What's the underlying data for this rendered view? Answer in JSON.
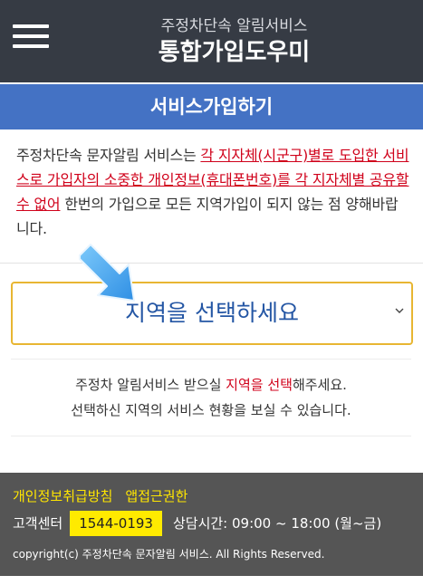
{
  "header": {
    "subtitle": "주정차단속 알림서비스",
    "title": "통합가입도우미"
  },
  "section": {
    "title": "서비스가입하기"
  },
  "notice": {
    "part1": "주정차단속 문자알림 서비스는 ",
    "highlight": "각 지자체(시군구)별로 도입한 서비스로 가입자의 소중한 개인정보(휴대폰번호)를 각 지자체별 공유할 수 없어",
    "part2": " 한번의 가입으로 모든 지역가입이 되지 않는 점 양해바랍니다."
  },
  "region_select": {
    "label": "지역을 선택하세요",
    "icon": "chevron-down-icon"
  },
  "pointer": {
    "icon": "arrow-pointer-icon",
    "color": "#3aa3ef"
  },
  "info": {
    "line1_before": "주정차 알림서비스 받으실 ",
    "line1_highlight": "지역을 선택",
    "line1_after": "해주세요.",
    "line2": "선택하신 지역의 서비스 현황을 보실 수 있습니다."
  },
  "footer": {
    "privacy_link": "개인정보취급방침",
    "permission_link": "앱접근권한",
    "contact_label": "고객센터",
    "phone": "1544-0193",
    "hours": "상담시간: 09:00 ~ 18:00 (월~금)",
    "copyright": "copyright(c) 주정차단속 문자알림 서비스. All Rights Reserved."
  },
  "colors": {
    "header_bg": "#363b44",
    "section_bg": "#4472c4",
    "highlight_red": "#d0021b",
    "select_border": "#e8b632",
    "select_text": "#2456a4",
    "footer_bg": "#555555",
    "footer_link": "#ffe600"
  }
}
